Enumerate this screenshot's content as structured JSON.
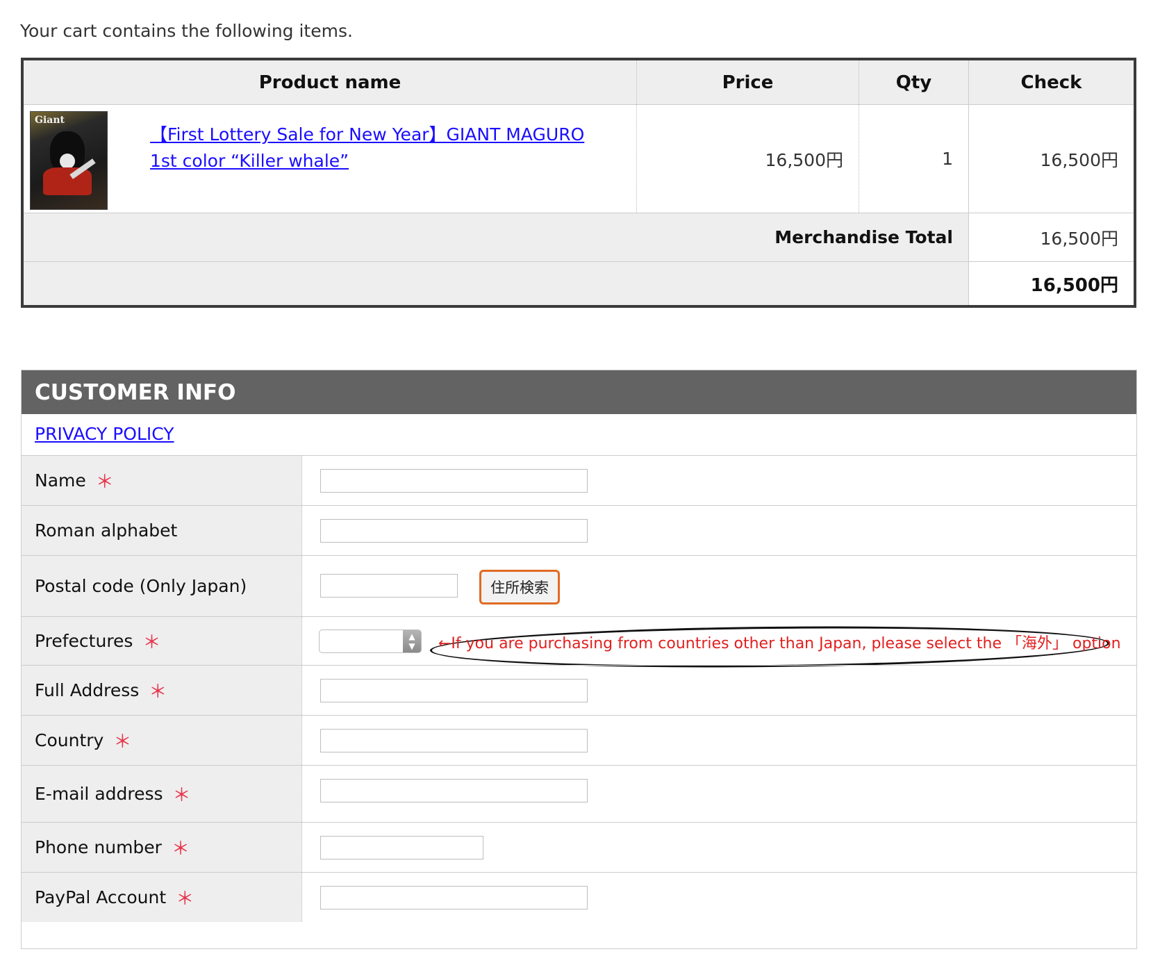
{
  "intro": "Your cart contains the following items.",
  "cart": {
    "headers": {
      "product": "Product name",
      "price": "Price",
      "qty": "Qty",
      "check": "Check"
    },
    "item": {
      "name": "【First Lottery Sale for New Year】GIANT MAGURO 1st color “Killer whale”",
      "thumb_logo": "Giant",
      "price": "16,500円",
      "qty": "1",
      "check": "16,500円"
    },
    "merch_label": "Merchandise Total",
    "merch_total": "16,500円",
    "grand_total": "16,500円"
  },
  "customer": {
    "title": "CUSTOMER INFO",
    "privacy": "PRIVACY POLICY",
    "required_mark": "＊",
    "fields": {
      "name": "Name",
      "roman": "Roman alphabet",
      "postal": "Postal code (Only Japan)",
      "prefectures": "Prefectures",
      "address": "Full Address",
      "country": "Country",
      "email": "E-mail address",
      "phone": "Phone number",
      "paypal": "PayPal Account"
    },
    "search_button": "住所検索",
    "prefecture_note": "←If you are purchasing from countries other than Japan, please select the 「海外」 option"
  },
  "colors": {
    "link": "#1a0dff",
    "header_bg": "#636363",
    "required": "#e8334a",
    "note": "#e0201f",
    "button_border": "#e06a22"
  }
}
